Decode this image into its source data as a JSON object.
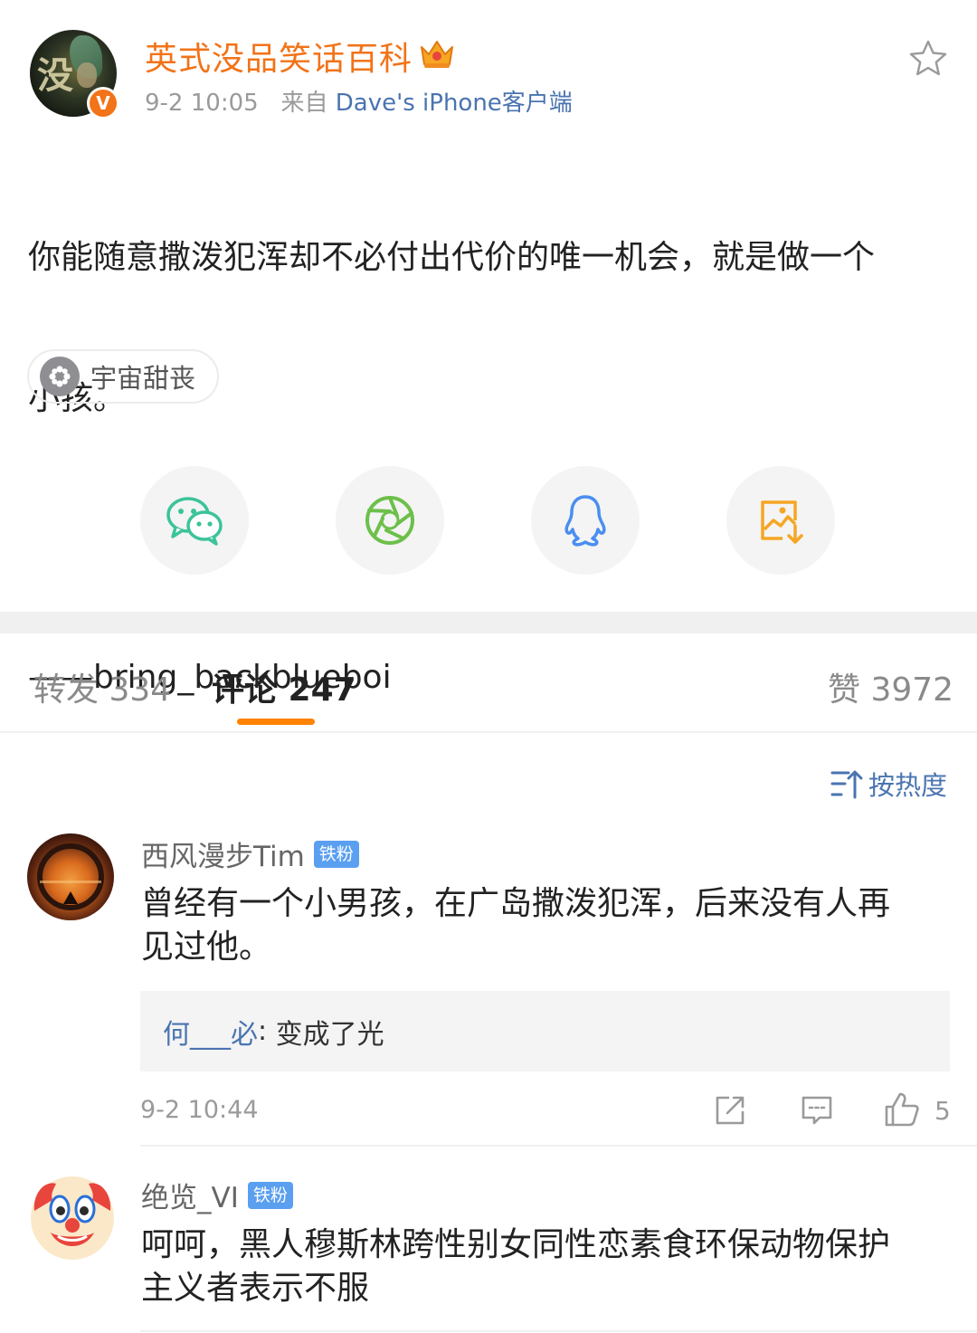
{
  "post": {
    "username": "英式没品笑话百科",
    "timestamp": "9-2 10:05",
    "source_prefix": "来自",
    "source_name": "Dave's iPhone客户端",
    "text_line1": "你能随意撒泼犯浑却不必付出代价的唯一机会，就是做一个",
    "text_line2": "小孩。",
    "text_line3": "——bring_backblueboi",
    "topic": "宇宙甜丧",
    "verified_badge": "V"
  },
  "share": [
    "wechat-icon",
    "moments-icon",
    "qq-icon",
    "save-image-icon"
  ],
  "tabs": {
    "repost": "转发 334",
    "comments": "评论 247",
    "likes": "赞 3972"
  },
  "sort_label": "按热度",
  "comments": [
    {
      "username": "西风漫步Tim",
      "badge": "铁粉",
      "text_line1": "曾经有一个小男孩，在广岛撒泼犯浑，后来没有人再",
      "text_line2": "见过他。",
      "reply_user": "何___必",
      "reply_sep": ": ",
      "reply_text": "变成了光",
      "time": "9-2 10:44",
      "likes": "5"
    },
    {
      "username": "绝览_VI",
      "badge": "铁粉",
      "text_line1": "呵呵，黑人穆斯林跨性别女同性恋素食环保动物保护",
      "text_line2": "主义者表示不服"
    }
  ],
  "colors": {
    "accent_orange": "#f27318",
    "link_blue": "#4a74b0",
    "tab_underline": "#ff8200",
    "wechat_green": "#3cc39a",
    "qq_blue": "#4a8ef0",
    "save_orange": "#f5a623"
  }
}
